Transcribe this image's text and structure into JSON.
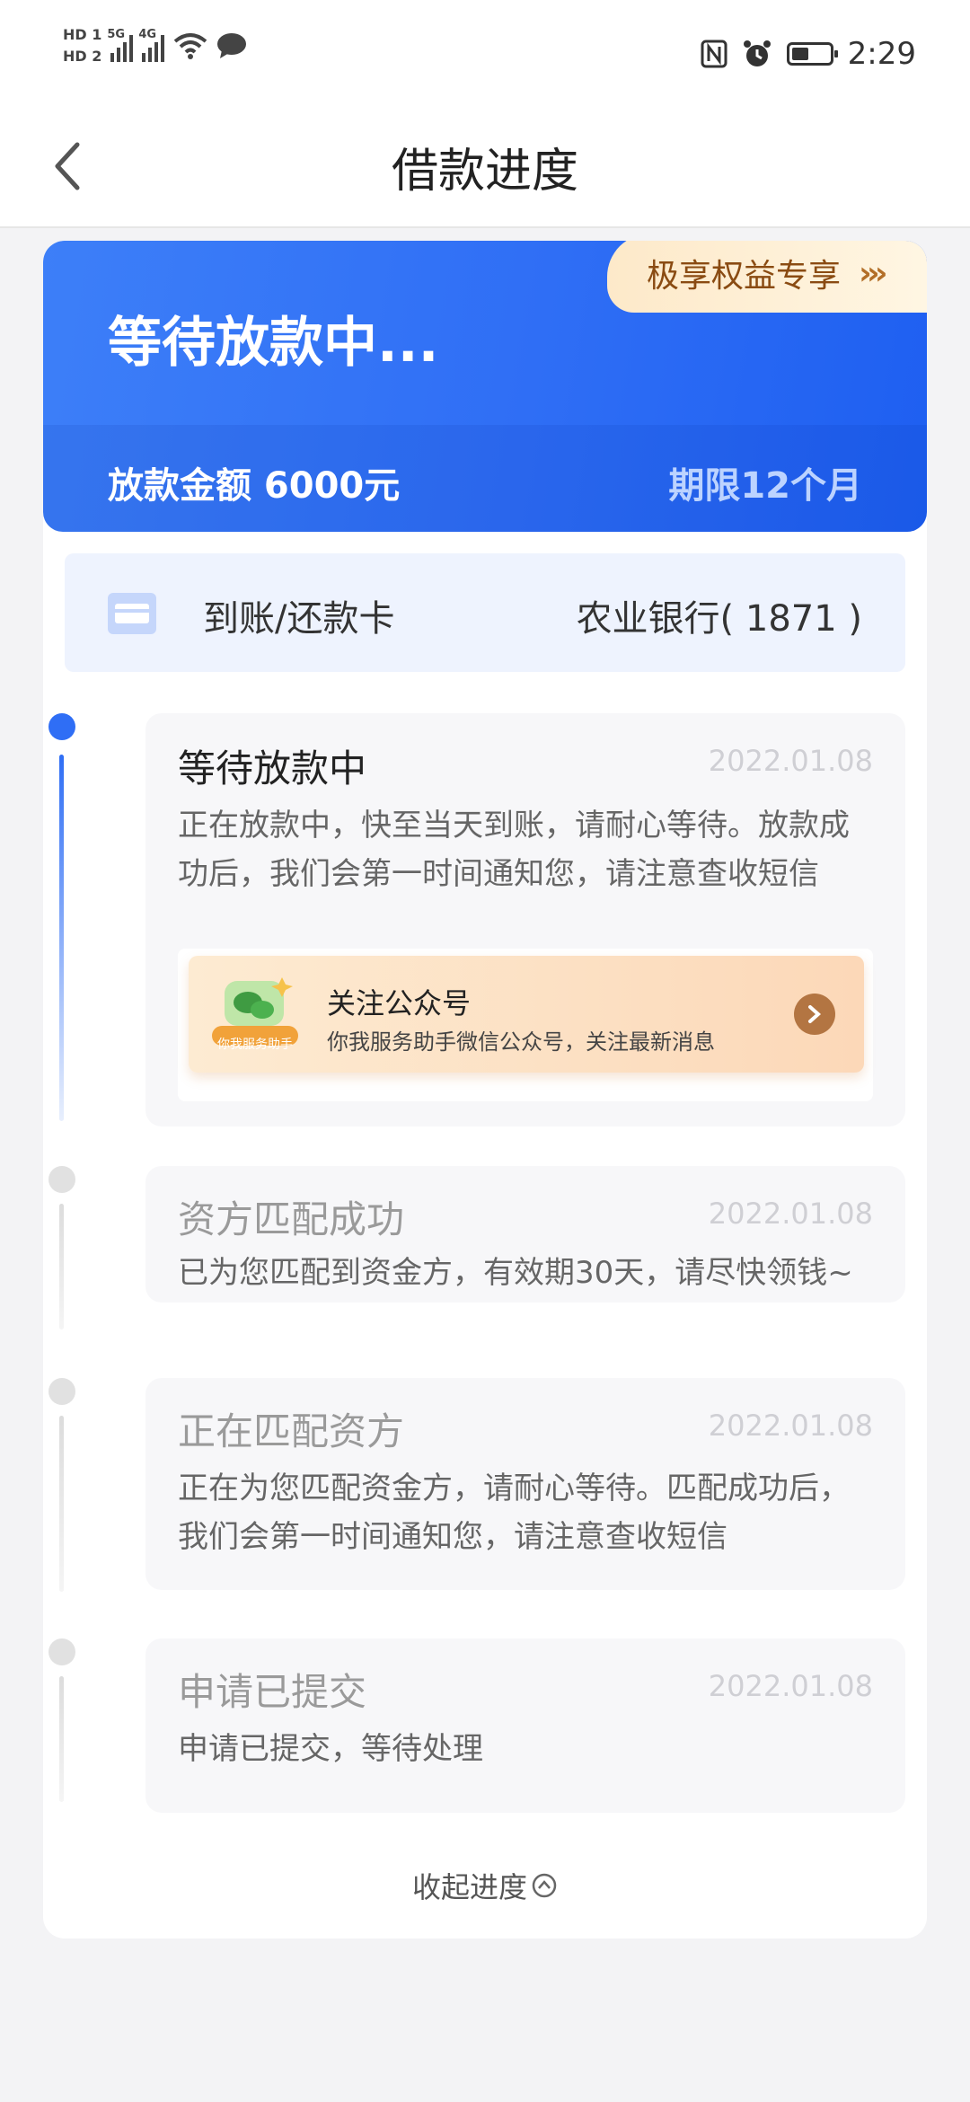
{
  "status_bar": {
    "sim1": "HD 1",
    "sim2": "HD 2",
    "net1": "5G",
    "net2": "4G",
    "time": "2:29",
    "battery_level": 0.45,
    "icons": [
      "nfc-icon",
      "alarm-icon",
      "battery-icon",
      "wifi-icon",
      "message-icon"
    ]
  },
  "header": {
    "title": "借款进度"
  },
  "hero": {
    "status": "等待放款中...",
    "perk_label": "极享权益专享",
    "perk_arrows": "›››",
    "amount": "放款金额 6000元",
    "term": "期限12个月"
  },
  "bank": {
    "label": "到账/还款卡",
    "value": "农业银行( 1871 )"
  },
  "steps": [
    {
      "title": "等待放款中",
      "date": "2022.01.08",
      "desc": "正在放款中，快至当天到账，请耐心等待。放款成功后，我们会第一时间通知您，请注意查收短信"
    },
    {
      "title": "资方匹配成功",
      "date": "2022.01.08",
      "desc": "已为您匹配到资金方，有效期30天，请尽快领钱~"
    },
    {
      "title": "正在匹配资方",
      "date": "2022.01.08",
      "desc": "正在为您匹配资金方，请耐心等待。匹配成功后，我们会第一时间通知您，请注意查收短信"
    },
    {
      "title": "申请已提交",
      "date": "2022.01.08",
      "desc": "申请已提交，等待处理"
    }
  ],
  "follow": {
    "badge": "你我服务助手",
    "title": "关注公众号",
    "subtitle": "你我服务助手微信公众号，关注最新消息"
  },
  "collapse_label": "收起进度",
  "colors": {
    "primary": "#2f6ef5",
    "perk_text": "#8a4b12",
    "bank_bg": "#eef3fe"
  }
}
